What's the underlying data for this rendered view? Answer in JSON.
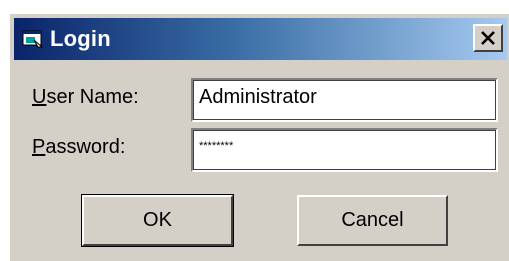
{
  "window": {
    "title": "Login",
    "close_glyph": "X"
  },
  "form": {
    "user_label_mnemonic": "U",
    "user_label_rest": "ser Name:",
    "user_value": "Administrator",
    "password_label_mnemonic": "P",
    "password_label_rest": "assword:",
    "password_masked": "********"
  },
  "buttons": {
    "ok_label": "OK",
    "cancel_label": "Cancel"
  },
  "icons": {
    "title": "window-app-icon",
    "close": "close-icon"
  },
  "colors": {
    "titlebar_start": "#0a246a",
    "titlebar_end": "#a6caf0",
    "dialog_face": "#d4d0c8"
  }
}
